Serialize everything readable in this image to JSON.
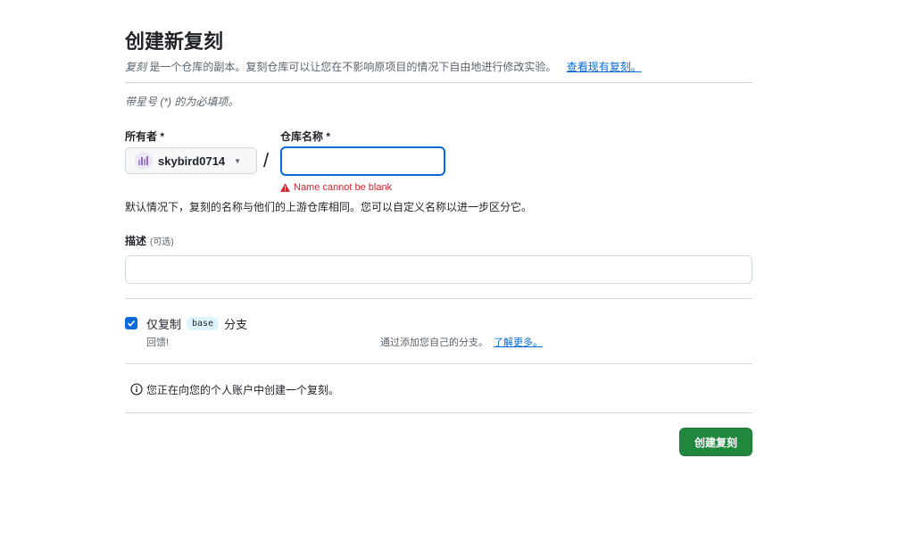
{
  "header": {
    "title": "创建新复刻",
    "subtitle_em": "复刻",
    "subtitle_text": "是一个仓库的副本。复刻仓库可以让您在不影响原项目的情况下自由地进行修改实验。",
    "view_forks_link": "查看现有复刻。"
  },
  "required_note": "带星号 (*) 的为必填项。",
  "owner": {
    "label": "所有者 *",
    "selected": "skybird0714"
  },
  "repo": {
    "label": "仓库名称 *",
    "value": "",
    "error": "Name cannot be blank"
  },
  "default_note": "默认情况下，复刻的名称与他们的上游仓库相同。您可以自定义名称以进一步区分它。",
  "description": {
    "label": "描述",
    "optional": "(可选)",
    "value": ""
  },
  "branch": {
    "checked": true,
    "prefix": "仅复制",
    "branch_name": "base",
    "suffix": "分支",
    "help_left": "回馈!",
    "help_right": "通过添加您自己的分支。",
    "learn_more": "了解更多。"
  },
  "info": "您正在向您的个人账户中创建一个复刻。",
  "create_button": "创建复刻",
  "colors": {
    "primary": "#1f883d",
    "link": "#0969da",
    "error": "#d1242f"
  }
}
